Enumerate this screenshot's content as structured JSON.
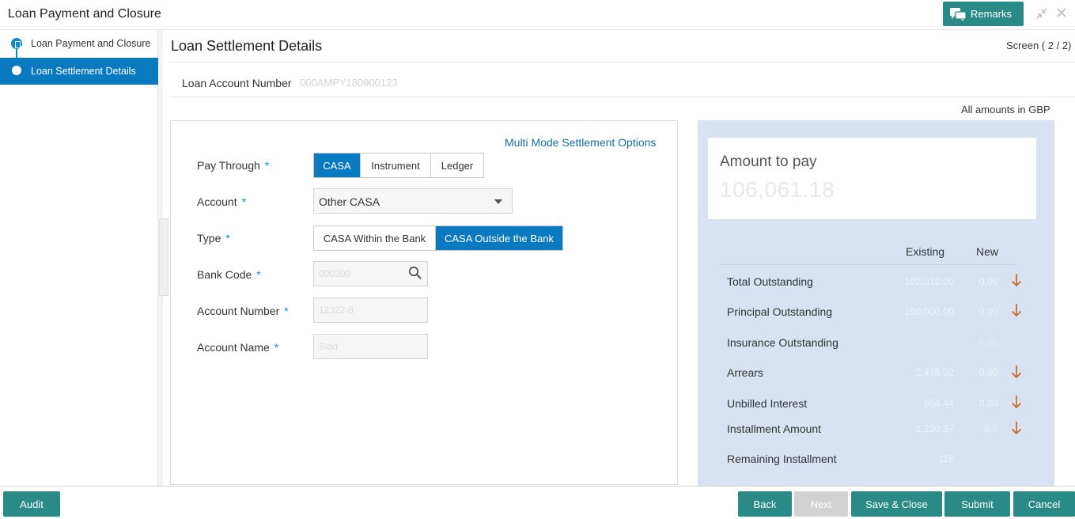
{
  "header": {
    "title": "Loan Payment and Closure",
    "remarks_label": "Remarks",
    "minimize_icon": "collapse-icon",
    "close_icon": "close-icon"
  },
  "sidebar": {
    "items": [
      {
        "label": "Loan Payment and Closure"
      },
      {
        "label": "Loan Settlement Details"
      }
    ]
  },
  "main": {
    "title": "Loan Settlement Details",
    "screen_count": "Screen ( 2 / 2)",
    "loan_account_label": "Loan Account Number",
    "loan_account_value": "000AMPY180900123",
    "amount_note": "All amounts in GBP"
  },
  "form": {
    "multi_mode_link": "Multi Mode Settlement Options",
    "pay_through": {
      "label": "Pay Through",
      "required": "*",
      "options": [
        "CASA",
        "Instrument",
        "Ledger"
      ],
      "selected": "CASA"
    },
    "account": {
      "label": "Account",
      "required": "*",
      "value": "Other CASA"
    },
    "type": {
      "label": "Type",
      "required": "*",
      "options": [
        "CASA Within the Bank",
        "CASA Outside the Bank"
      ],
      "selected": "CASA Outside the Bank"
    },
    "bank_code": {
      "label": "Bank Code",
      "required": "*",
      "value": "000300"
    },
    "account_number": {
      "label": "Account Number",
      "required": "*",
      "value": "12322-8"
    },
    "account_name": {
      "label": "Account Name",
      "required": "*",
      "value": "Sidd"
    }
  },
  "summary": {
    "amount_label": "Amount to pay",
    "amount_value": "106,061.18",
    "col_existing": "Existing",
    "col_new": "New",
    "rows": [
      {
        "label": "Total Outstanding",
        "existing": "102,012.00",
        "new": "0.00",
        "arrow": true
      },
      {
        "label": "Principal Outstanding",
        "existing": "100,000.00",
        "new": "0.00",
        "arrow": true
      },
      {
        "label": "Insurance Outstanding",
        "existing": "",
        "new": "0.00",
        "arrow": false
      },
      {
        "label": "Arrears",
        "existing": "2,475.02",
        "new": "0.00",
        "arrow": true
      },
      {
        "label": "Unbilled Interest",
        "existing": "654.44",
        "new": "0.00",
        "arrow": true
      },
      {
        "label": "Installment Amount",
        "existing": "1,230.37",
        "new": "0.0",
        "arrow": true
      },
      {
        "label": "Remaining Installment",
        "existing": "118",
        "new": "",
        "arrow": false
      }
    ],
    "arrow_color": "#c8702a"
  },
  "footer": {
    "audit": "Audit",
    "back": "Back",
    "next": "Next",
    "save_close": "Save & Close",
    "submit": "Submit",
    "cancel": "Cancel"
  }
}
